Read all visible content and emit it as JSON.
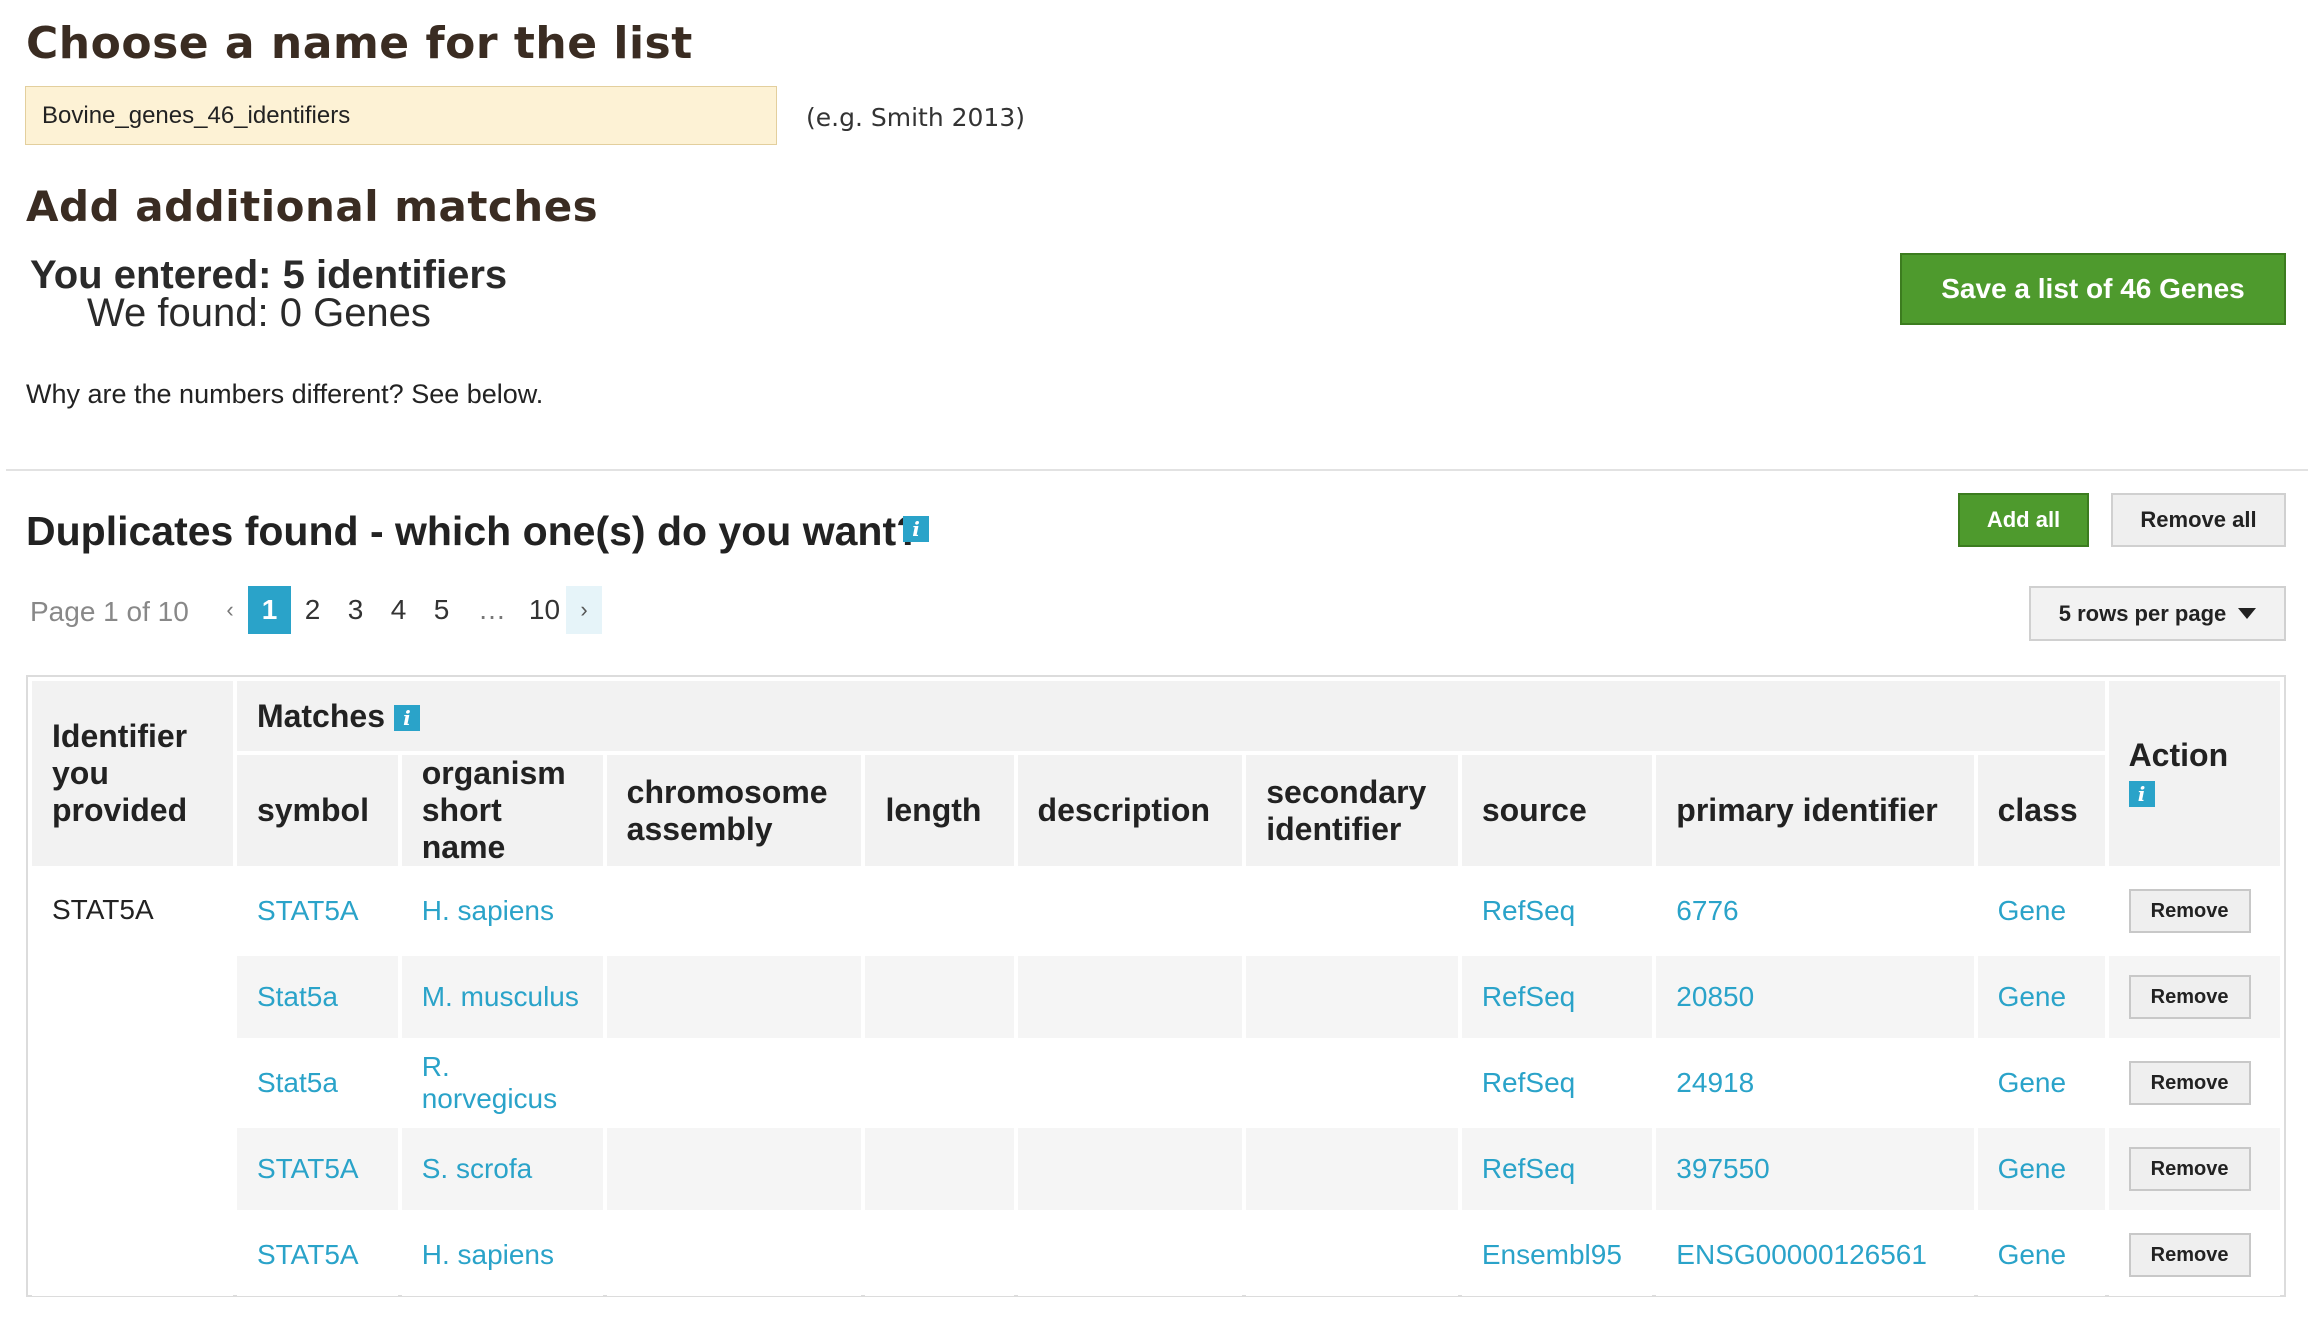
{
  "name_section": {
    "title": "Choose a name for the list",
    "input_value": "Bovine_genes_46_identifiers",
    "hint": "(e.g. Smith 2013)"
  },
  "add_section": {
    "title": "Add additional matches",
    "you_entered": "You entered: 5 identifiers",
    "we_found": "We found: 0 Genes",
    "why": "Why are the numbers different? See below.",
    "save_button": "Save a list of 46 Genes"
  },
  "duplicates": {
    "title": "Duplicates found - which one(s) do you want?",
    "info_icon": "i",
    "add_all": "Add all",
    "remove_all": "Remove all",
    "page_label": "Page 1 of 10",
    "pagination": {
      "prev": "‹",
      "pages": [
        "1",
        "2",
        "3",
        "4",
        "5"
      ],
      "ellipsis": "…",
      "last": "10",
      "next": "›",
      "current": "1"
    },
    "rows_per_page": "5 rows per page"
  },
  "table": {
    "headers": {
      "identifier": "Identifier you provided",
      "matches": "Matches",
      "action": "Action",
      "columns": [
        "symbol",
        "organism short name",
        "chromosome assembly",
        "length",
        "description",
        "secondary identifier",
        "source",
        "primary identifier",
        "class"
      ]
    },
    "identifier": "STAT5A",
    "remove_label": "Remove",
    "rows": [
      {
        "symbol": "STAT5A",
        "organism": "H. sapiens",
        "chromosome": "",
        "length": "",
        "description": "",
        "secondary": "",
        "source": "RefSeq",
        "primary": "6776",
        "class": "Gene"
      },
      {
        "symbol": "Stat5a",
        "organism": "M. musculus",
        "chromosome": "",
        "length": "",
        "description": "",
        "secondary": "",
        "source": "RefSeq",
        "primary": "20850",
        "class": "Gene"
      },
      {
        "symbol": "Stat5a",
        "organism": "R. norvegicus",
        "chromosome": "",
        "length": "",
        "description": "",
        "secondary": "",
        "source": "RefSeq",
        "primary": "24918",
        "class": "Gene"
      },
      {
        "symbol": "STAT5A",
        "organism": "S. scrofa",
        "chromosome": "",
        "length": "",
        "description": "",
        "secondary": "",
        "source": "RefSeq",
        "primary": "397550",
        "class": "Gene"
      },
      {
        "symbol": "STAT5A",
        "organism": "H. sapiens",
        "chromosome": "",
        "length": "",
        "description": "",
        "secondary": "",
        "source": "Ensembl95",
        "primary": "ENSG00000126561",
        "class": "Gene"
      }
    ]
  },
  "colors": {
    "accent": "#2aa3c9",
    "green": "#4e9a2d",
    "input_bg": "#fdf2d5",
    "heading": "#3a2c22"
  }
}
